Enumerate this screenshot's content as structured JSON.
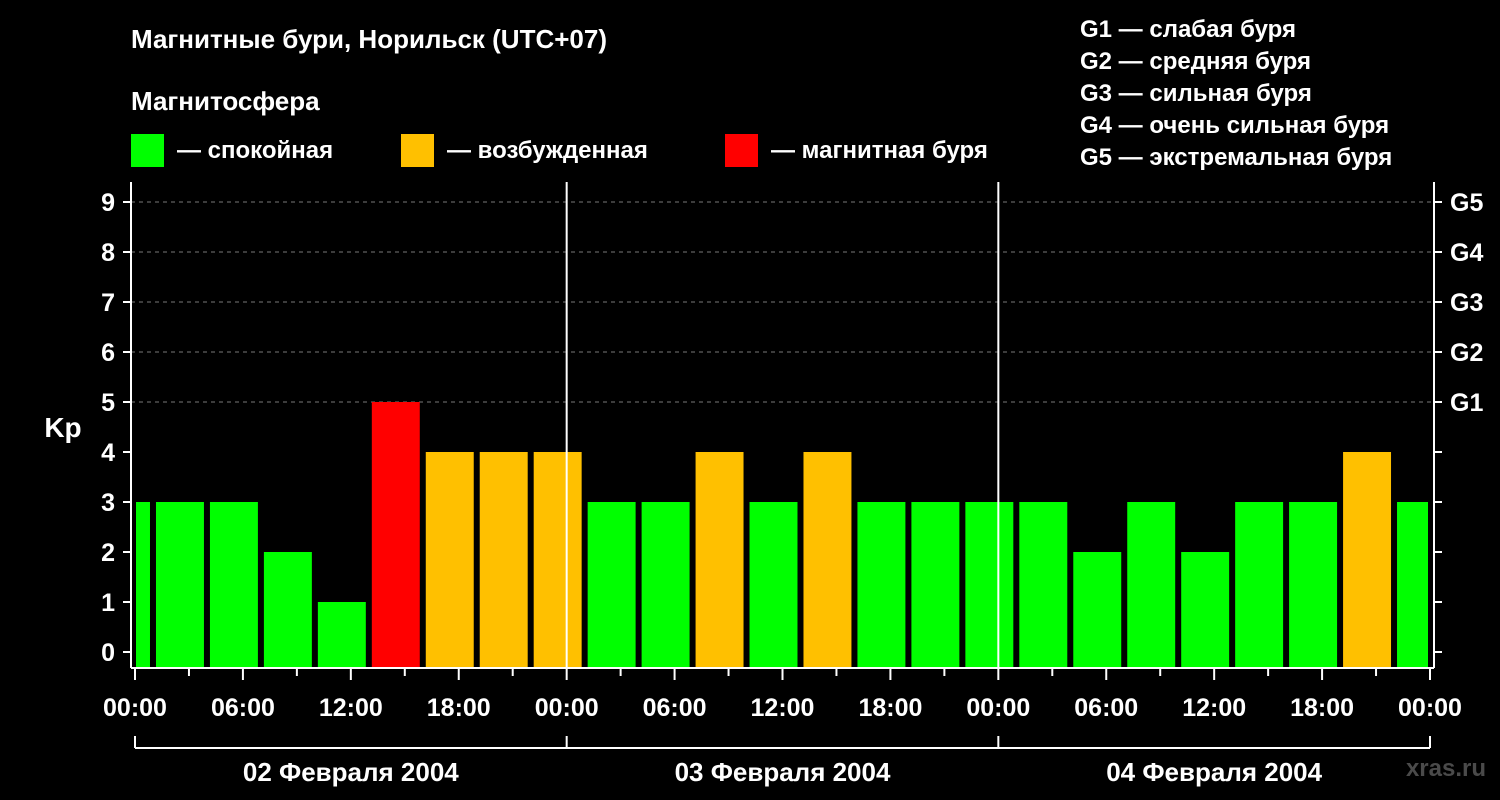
{
  "title": "Магнитные бури, Норильск (UTC+07)",
  "subtitle": "Магнитосфера",
  "legend": [
    {
      "label": "— спокойная",
      "color": "#00ff00"
    },
    {
      "label": "— возбужденная",
      "color": "#ffc000"
    },
    {
      "label": "— магнитная буря",
      "color": "#ff0000"
    }
  ],
  "g_scale": [
    "G1 — слабая буря",
    "G2 — средняя буря",
    "G3 — сильная буря",
    "G4 — очень сильная буря",
    "G5 — экстремальная буря"
  ],
  "watermark": "xras.ru",
  "chart_data": {
    "type": "bar",
    "ylabel": "Kp",
    "ylim": [
      0,
      9
    ],
    "yticks": [
      "0",
      "1",
      "2",
      "3",
      "4",
      "5",
      "6",
      "7",
      "8",
      "9"
    ],
    "right_ticks": [
      {
        "kp": 5,
        "label": "G1"
      },
      {
        "kp": 6,
        "label": "G2"
      },
      {
        "kp": 7,
        "label": "G3"
      },
      {
        "kp": 8,
        "label": "G4"
      },
      {
        "kp": 9,
        "label": "G5"
      }
    ],
    "grid": "dashed horizontal",
    "x_tick_labels": [
      "00:00",
      "06:00",
      "12:00",
      "18:00",
      "00:00",
      "06:00",
      "12:00",
      "18:00",
      "00:00",
      "06:00",
      "12:00",
      "18:00",
      "00:00"
    ],
    "days": [
      "02 Февраля 2004",
      "03 Февраля 2004",
      "04 Февраля 2004"
    ],
    "interval_hours": 3,
    "time_offset_hours": 1,
    "values": [
      3,
      3,
      3,
      2,
      1,
      5,
      4,
      4,
      4,
      3,
      3,
      4,
      3,
      4,
      3,
      3,
      3,
      3,
      2,
      3,
      2,
      3,
      3,
      4,
      3
    ],
    "colors": {
      "quiet": "#00ff00",
      "active": "#ffc000",
      "storm": "#ff0000"
    }
  }
}
